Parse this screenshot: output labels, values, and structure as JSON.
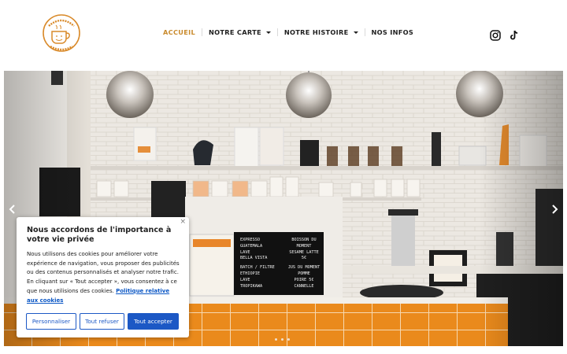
{
  "brand": {
    "logo_text_top": "Les Ateliers du",
    "logo_text_bottom": "Coffee Shop",
    "accent": "#c98a2c"
  },
  "nav": {
    "items": [
      {
        "label": "ACCUEIL",
        "active": true
      },
      {
        "label": "NOTRE CARTE",
        "dropdown": true
      },
      {
        "label": "NOTRE HISTOIRE",
        "dropdown": true
      },
      {
        "label": "NOS INFOS"
      }
    ]
  },
  "social": {
    "icons": [
      "instagram-icon",
      "tiktok-icon"
    ]
  },
  "hero": {
    "slide_count": 3,
    "menu_board_left": [
      "EXPRESSO",
      "GUATEMALA",
      "LAVE",
      "BELLA VISTA",
      "",
      "BATCH / FILTRE",
      "ETHIOPIE",
      "LAVE",
      "TROPIKAWA"
    ],
    "menu_board_right": [
      "BOISSON DU",
      "MOMENT",
      "SESAME LATTE",
      "5€",
      "",
      "JUS DU MOMENT",
      "POMME",
      "POIRE   5€",
      "CANNELLE"
    ]
  },
  "cookie": {
    "close": "×",
    "title": "Nous accordons de l'importance à votre vie privée",
    "text": "Nous utilisons des cookies pour améliorer votre expérience de navigation, vous proposer des publicités ou des contenus personnalisés et analyser notre trafic. En cliquant sur « Tout accepter », vous consentez à ce que nous utilisions des cookies.",
    "policy_link": "Politique relative aux cookies",
    "buttons": {
      "customize": "Personnaliser",
      "refuse": "Tout refuser",
      "accept": "Tout accepter"
    },
    "brand_color": "#1c58c5"
  }
}
